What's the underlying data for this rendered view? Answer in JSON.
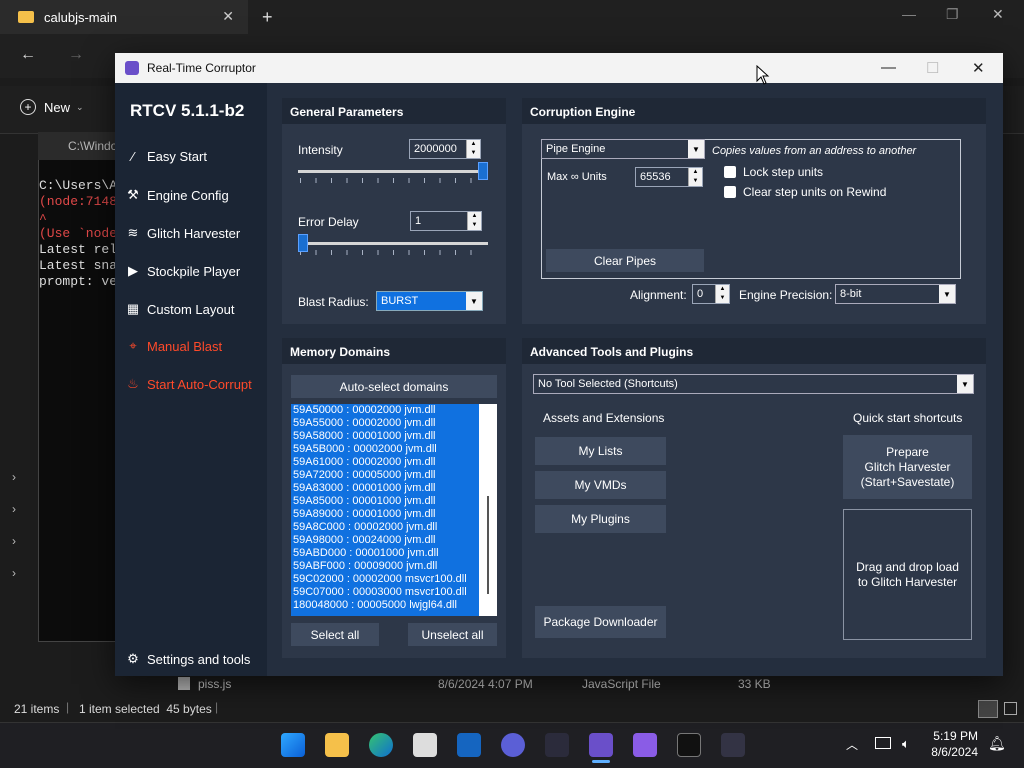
{
  "explorer": {
    "tab_title": "calubjs-main",
    "new_label": "New",
    "console_title": "C:\\Windo",
    "console_lines": [
      "C:\\Users\\A",
      "(node:7148",
      "^",
      "(Use `node",
      "Latest rel",
      "Latest sna",
      "prompt: ve"
    ],
    "file_name": "piss.js",
    "file_date": "8/6/2024 4:07 PM",
    "file_type": "JavaScript File",
    "file_size": "33 KB",
    "status_items": "21 items",
    "status_selected": "1 item selected  45 bytes"
  },
  "taskbar": {
    "time": "5:19 PM",
    "date": "8/6/2024"
  },
  "rtcv": {
    "window_title": "Real-Time Corruptor",
    "version": "RTCV 5.1.1-b2",
    "sidebar": [
      {
        "label": "Easy Start",
        "icon": "wand-icon"
      },
      {
        "label": "Engine Config",
        "icon": "wrench-icon"
      },
      {
        "label": "Glitch Harvester",
        "icon": "layers-icon"
      },
      {
        "label": "Stockpile Player",
        "icon": "play-icon"
      },
      {
        "label": "Custom Layout",
        "icon": "grid-icon"
      },
      {
        "label": "Manual Blast",
        "icon": "crosshair-icon"
      },
      {
        "label": "Start Auto-Corrupt",
        "icon": "fire-icon"
      }
    ],
    "settings_label": "Settings and tools",
    "general": {
      "title": "General Parameters",
      "intensity_label": "Intensity",
      "intensity_value": "2000000",
      "intensity_fraction": 1.0,
      "error_delay_label": "Error Delay",
      "error_delay_value": "1",
      "error_delay_fraction": 0.0,
      "blast_radius_label": "Blast Radius:",
      "blast_radius_value": "BURST"
    },
    "engine": {
      "title": "Corruption Engine",
      "selected_engine": "Pipe Engine",
      "description": "Copies values from an address to another",
      "max_units_label": "Max ∞ Units",
      "max_units_value": "65536",
      "lock_step_label": "Lock step units",
      "clear_step_label": "Clear step units on Rewind",
      "clear_pipes_label": "Clear Pipes",
      "alignment_label": "Alignment:",
      "alignment_value": "0",
      "precision_label": "Engine Precision:",
      "precision_value": "8-bit"
    },
    "memory": {
      "title": "Memory Domains",
      "auto_select_label": "Auto-select domains",
      "domains": [
        "59A50000 : 00002000 jvm.dll",
        "59A55000 : 00002000 jvm.dll",
        "59A58000 : 00001000 jvm.dll",
        "59A5B000 : 00002000 jvm.dll",
        "59A61000 : 00002000 jvm.dll",
        "59A72000 : 00005000 jvm.dll",
        "59A83000 : 00001000 jvm.dll",
        "59A85000 : 00001000 jvm.dll",
        "59A89000 : 00001000 jvm.dll",
        "59A8C000 : 00002000 jvm.dll",
        "59A98000 : 00024000 jvm.dll",
        "59ABD000 : 00001000 jvm.dll",
        "59ABF000 : 00009000 jvm.dll",
        "59C02000 : 00002000 msvcr100.dll",
        "59C07000 : 00003000 msvcr100.dll",
        "180048000 : 00005000 lwjgl64.dll"
      ],
      "select_all_label": "Select all",
      "unselect_all_label": "Unselect all"
    },
    "advanced": {
      "title": "Advanced Tools and Plugins",
      "tool_select_value": "No Tool Selected (Shortcuts)",
      "assets_title": "Assets and Extensions",
      "my_lists_label": "My Lists",
      "my_vmds_label": "My VMDs",
      "my_plugins_label": "My Plugins",
      "package_downloader_label": "Package Downloader",
      "quick_title": "Quick start shortcuts",
      "prepare_line1": "Prepare",
      "prepare_line2": "Glitch Harvester",
      "prepare_line3": "(Start+Savestate)",
      "drop_line1": "Drag and drop load",
      "drop_line2": "to Glitch Harvester"
    }
  }
}
